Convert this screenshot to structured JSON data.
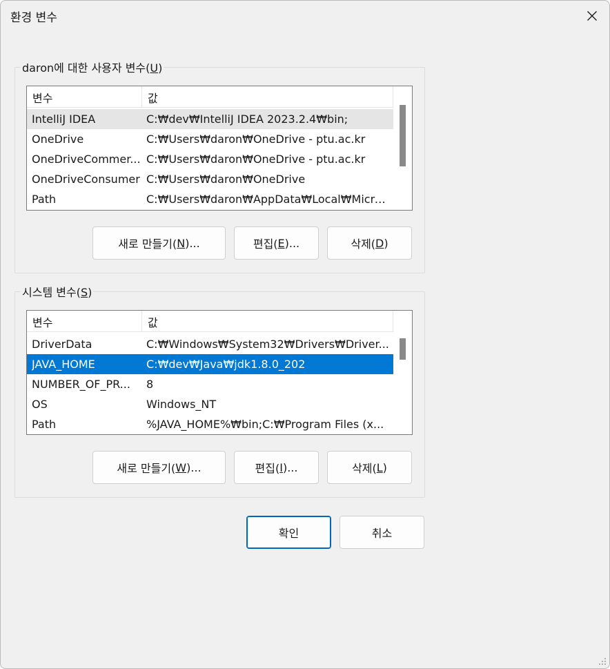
{
  "window": {
    "title": "환경 변수"
  },
  "user_vars": {
    "group_label_prefix": "daron에 대한 사용자 변수(",
    "group_label_key": "U",
    "group_label_suffix": ")",
    "col_name": "변수",
    "col_value": "값",
    "rows": [
      {
        "name": "IntelliJ IDEA",
        "value": "C:₩dev₩IntelliJ IDEA 2023.2.4₩bin;"
      },
      {
        "name": "OneDrive",
        "value": "C:₩Users₩daron₩OneDrive - ptu.ac.kr"
      },
      {
        "name": "OneDriveCommer...",
        "value": "C:₩Users₩daron₩OneDrive - ptu.ac.kr"
      },
      {
        "name": "OneDriveConsumer",
        "value": "C:₩Users₩daron₩OneDrive"
      },
      {
        "name": "Path",
        "value": "C:₩Users₩daron₩AppData₩Local₩Micro..."
      }
    ],
    "buttons": {
      "new_prefix": "새로 만들기(",
      "new_key": "N",
      "new_suffix": ")...",
      "edit_prefix": "편집(",
      "edit_key": "E",
      "edit_suffix": ")...",
      "delete_prefix": "삭제(",
      "delete_key": "D",
      "delete_suffix": ")"
    }
  },
  "system_vars": {
    "group_label_prefix": "시스템 변수(",
    "group_label_key": "S",
    "group_label_suffix": ")",
    "col_name": "변수",
    "col_value": "값",
    "rows": [
      {
        "name": "DriverData",
        "value": "C:₩Windows₩System32₩Drivers₩Driver..."
      },
      {
        "name": "JAVA_HOME",
        "value": "C:₩dev₩Java₩jdk1.8.0_202"
      },
      {
        "name": "NUMBER_OF_PR...",
        "value": "8"
      },
      {
        "name": "OS",
        "value": "Windows_NT"
      },
      {
        "name": "Path",
        "value": "%JAVA_HOME%₩bin;C:₩Program Files (x..."
      }
    ],
    "buttons": {
      "new_prefix": "새로 만들기(",
      "new_key": "W",
      "new_suffix": ")...",
      "edit_prefix": "편집(",
      "edit_key": "I",
      "edit_suffix": ")...",
      "delete_prefix": "삭제(",
      "delete_key": "L",
      "delete_suffix": ")"
    }
  },
  "footer": {
    "ok": "확인",
    "cancel": "취소"
  },
  "icons": {
    "close": "close-icon",
    "resize": "resize-grip-icon"
  },
  "colors": {
    "selection": "#0078d4",
    "accent_border": "#0067c0"
  }
}
